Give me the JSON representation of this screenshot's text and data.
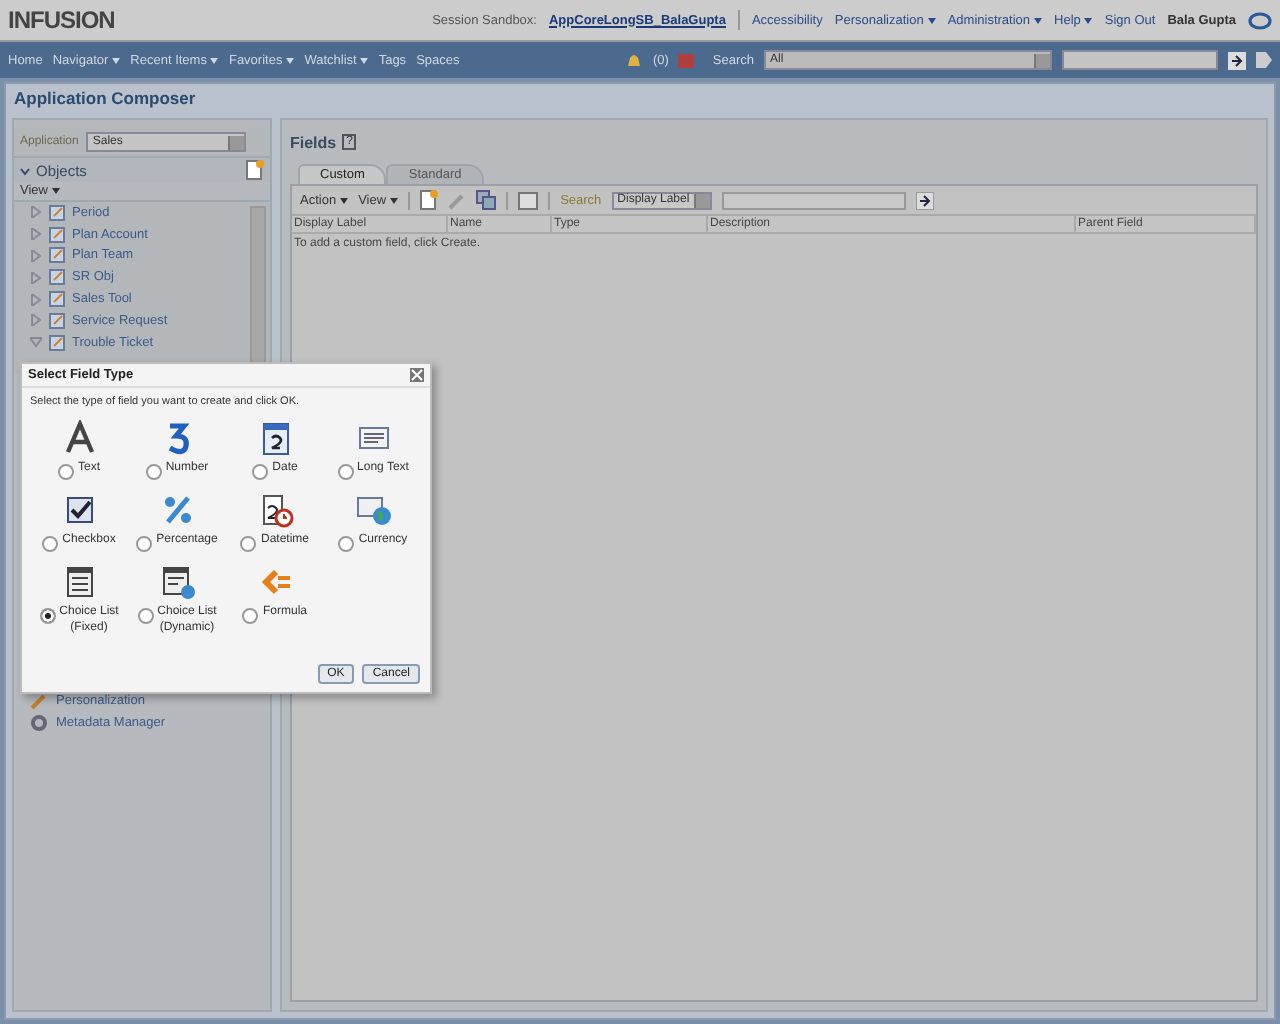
{
  "header": {
    "logo": "INFUSION",
    "sandbox_label": "Session Sandbox:",
    "sandbox_link": "AppCoreLongSB_BalaGupta",
    "links": [
      {
        "label": "Accessibility",
        "menu": false
      },
      {
        "label": "Personalization",
        "menu": true
      },
      {
        "label": "Administration",
        "menu": true
      },
      {
        "label": "Help",
        "menu": true
      },
      {
        "label": "Sign Out",
        "menu": false
      }
    ],
    "user": "Bala Gupta"
  },
  "nav": {
    "items": [
      {
        "label": "Home",
        "menu": false
      },
      {
        "label": "Navigator",
        "menu": true
      },
      {
        "label": "Recent Items",
        "menu": true
      },
      {
        "label": "Favorites",
        "menu": true
      },
      {
        "label": "Watchlist",
        "menu": true
      },
      {
        "label": "Tags",
        "menu": false
      },
      {
        "label": "Spaces",
        "menu": false
      }
    ],
    "notifications": "(0)",
    "search_label": "Search",
    "search_scope": "All"
  },
  "page": {
    "title": "Application Composer"
  },
  "sidebar": {
    "application_label": "Application",
    "application_value": "Sales",
    "objects_title": "Objects",
    "view_menu": "View",
    "objects": [
      {
        "label": "Period",
        "expanded": false
      },
      {
        "label": "Plan Account",
        "expanded": false
      },
      {
        "label": "Plan Team",
        "expanded": false
      },
      {
        "label": "SR Obj",
        "expanded": false
      },
      {
        "label": "Sales Tool",
        "expanded": false
      },
      {
        "label": "Service Request",
        "expanded": false
      },
      {
        "label": "Trouble Ticket",
        "expanded": true
      }
    ],
    "tools": [
      {
        "label": "Personalization"
      },
      {
        "label": "Metadata Manager"
      }
    ]
  },
  "fields": {
    "title": "Fields",
    "help": "?",
    "tabs": [
      {
        "label": "Custom",
        "selected": true
      },
      {
        "label": "Standard",
        "selected": false
      }
    ],
    "toolbar": {
      "action": "Action",
      "view": "View",
      "search_label": "Search",
      "search_field": "Display Label"
    },
    "columns": [
      "Display Label",
      "Name",
      "Type",
      "Description",
      "Parent Field"
    ],
    "empty_message": "To add a custom field, click Create."
  },
  "dialog": {
    "title": "Select Field Type",
    "instruction": "Select the type of field you want to create and click OK.",
    "options": [
      {
        "kind": "text",
        "label": "Text",
        "selected": false
      },
      {
        "kind": "number",
        "label": "Number",
        "selected": false
      },
      {
        "kind": "date",
        "label": "Date",
        "selected": false
      },
      {
        "kind": "longtext",
        "label": "Long Text",
        "selected": false
      },
      {
        "kind": "checkbox",
        "label": "Checkbox",
        "selected": false
      },
      {
        "kind": "percentage",
        "label": "Percentage",
        "selected": false
      },
      {
        "kind": "datetime",
        "label": "Datetime",
        "selected": false
      },
      {
        "kind": "currency",
        "label": "Currency",
        "selected": false
      },
      {
        "kind": "choicefixed",
        "label": "Choice List\n(Fixed)",
        "selected": true
      },
      {
        "kind": "choicedynamic",
        "label": "Choice List\n(Dynamic)",
        "selected": false
      },
      {
        "kind": "formula",
        "label": "Formula",
        "selected": false
      }
    ],
    "buttons": [
      "OK",
      "Cancel"
    ]
  }
}
